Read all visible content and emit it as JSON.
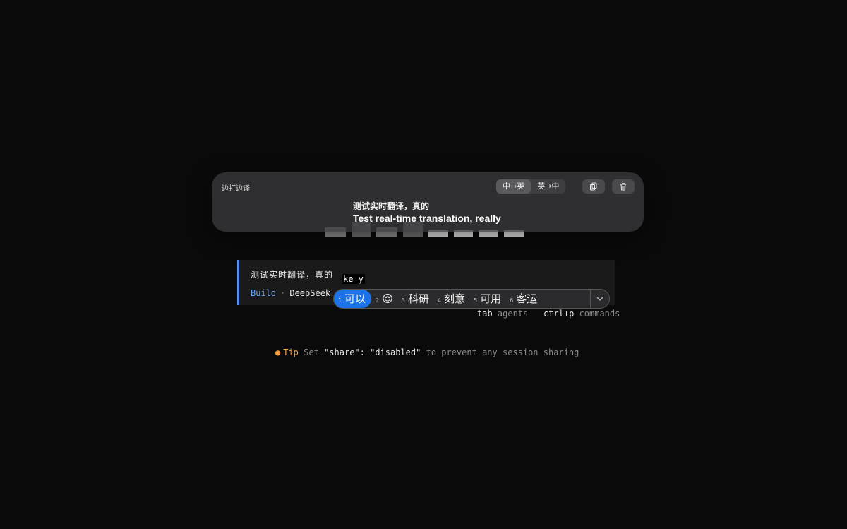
{
  "translator": {
    "title": "边打边译",
    "direction_options": [
      "中→英",
      "英→中"
    ],
    "active_direction_index": 0,
    "source_text": "测试实时翻译，真的",
    "translated_text": "Test real-time translation, really",
    "copy_icon": "copy-icon",
    "delete_icon": "trash-icon"
  },
  "prompt": {
    "input_text": "测试实时翻译，真的",
    "composing_text": "ke y",
    "mode": "Build",
    "model": "DeepSeek"
  },
  "ime": {
    "candidates": [
      {
        "num": "1",
        "text": "可以"
      },
      {
        "num": "2",
        "text": "😌"
      },
      {
        "num": "3",
        "text": "科研"
      },
      {
        "num": "4",
        "text": "刻意"
      },
      {
        "num": "5",
        "text": "可用"
      },
      {
        "num": "6",
        "text": "客运"
      }
    ],
    "selected_index": 0,
    "accent": "#1a73e8"
  },
  "hints": {
    "agents_key": "tab",
    "agents_label": "agents",
    "commands_key": "ctrl+p",
    "commands_label": "commands"
  },
  "tip": {
    "label": "Tip",
    "text_a": "Set",
    "code": "\"share\": \"disabled\"",
    "text_b": "to prevent any session sharing",
    "accent": "#f0a040"
  }
}
